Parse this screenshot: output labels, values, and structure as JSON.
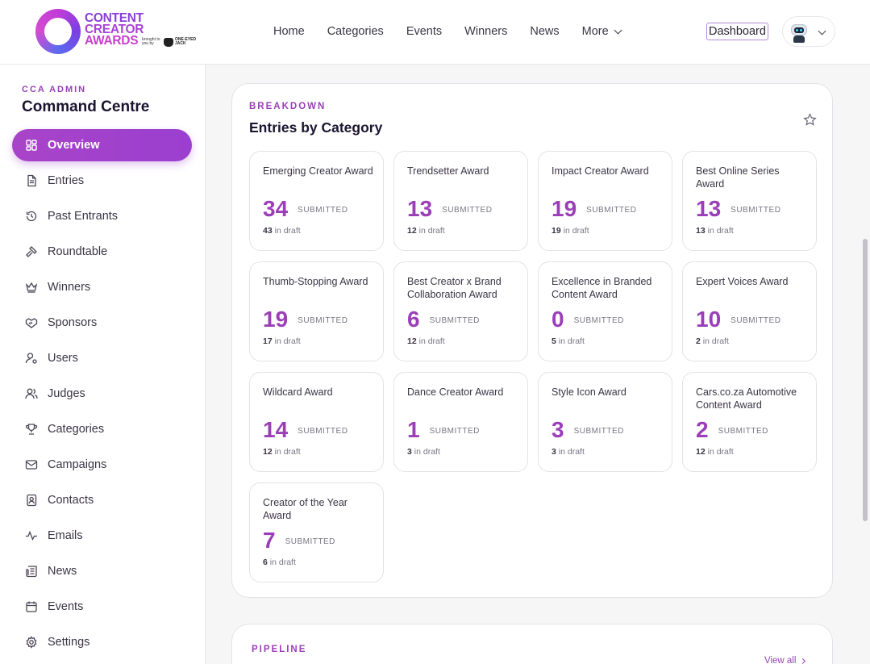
{
  "brand": {
    "logo_line1": "CONTENT",
    "logo_line2": "CREATOR",
    "logo_line3": "AWARDS",
    "logo_sub": "brought to you by",
    "logo_partner": "ONE-EYED JACK"
  },
  "nav": {
    "items": [
      "Home",
      "Categories",
      "Events",
      "Winners",
      "News"
    ],
    "more_label": "More",
    "dashboard_label": "Dashboard"
  },
  "sidebar": {
    "kicker": "CCA ADMIN",
    "title": "Command Centre",
    "items": [
      {
        "label": "Overview",
        "icon": "grid-icon",
        "active": true
      },
      {
        "label": "Entries",
        "icon": "document-icon"
      },
      {
        "label": "Past Entrants",
        "icon": "history-icon"
      },
      {
        "label": "Roundtable",
        "icon": "gavel-icon"
      },
      {
        "label": "Winners",
        "icon": "crown-icon"
      },
      {
        "label": "Sponsors",
        "icon": "handshake-icon"
      },
      {
        "label": "Users",
        "icon": "user-gear-icon"
      },
      {
        "label": "Judges",
        "icon": "users-icon"
      },
      {
        "label": "Categories",
        "icon": "trophy-icon"
      },
      {
        "label": "Campaigns",
        "icon": "mail-icon"
      },
      {
        "label": "Contacts",
        "icon": "contact-book-icon"
      },
      {
        "label": "Emails",
        "icon": "activity-icon"
      },
      {
        "label": "News",
        "icon": "newspaper-icon"
      },
      {
        "label": "Events",
        "icon": "calendar-icon"
      },
      {
        "label": "Settings",
        "icon": "gear-icon"
      }
    ]
  },
  "breakdown": {
    "kicker": "BREAKDOWN",
    "title": "Entries by Category",
    "submitted_label": "SUBMITTED",
    "draft_suffix": "in draft",
    "categories": [
      {
        "name": "Emerging Creator Award",
        "submitted": "34",
        "draft": "43"
      },
      {
        "name": "Trendsetter Award",
        "submitted": "13",
        "draft": "12"
      },
      {
        "name": "Impact Creator Award",
        "submitted": "19",
        "draft": "19"
      },
      {
        "name": "Best Online Series Award",
        "submitted": "13",
        "draft": "13"
      },
      {
        "name": "Thumb-Stopping Award",
        "submitted": "19",
        "draft": "17"
      },
      {
        "name": "Best Creator x Brand Collaboration Award",
        "submitted": "6",
        "draft": "12"
      },
      {
        "name": "Excellence in Branded Content Award",
        "submitted": "0",
        "draft": "5"
      },
      {
        "name": "Expert Voices Award",
        "submitted": "10",
        "draft": "2"
      },
      {
        "name": "Wildcard Award",
        "submitted": "14",
        "draft": "12"
      },
      {
        "name": "Dance Creator Award",
        "submitted": "1",
        "draft": "3"
      },
      {
        "name": "Style Icon Award",
        "submitted": "3",
        "draft": "3"
      },
      {
        "name": "Cars.co.za Automotive Content Award",
        "submitted": "2",
        "draft": "12"
      },
      {
        "name": "Creator of the Year Award",
        "submitted": "7",
        "draft": "6"
      }
    ]
  },
  "pipeline": {
    "kicker": "PIPELINE",
    "view_all": "View all"
  }
}
